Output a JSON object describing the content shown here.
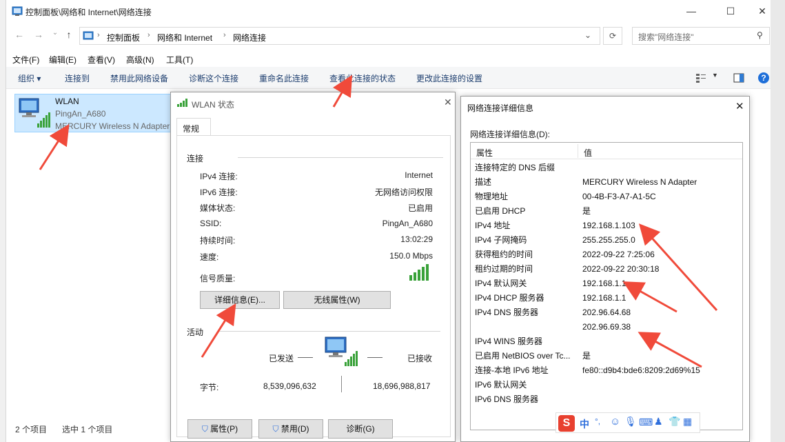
{
  "window": {
    "title": "控制面板\\网络和 Internet\\网络连接",
    "minimize": "—",
    "maximize": "☐",
    "close": "✕"
  },
  "address": {
    "crumbs": [
      "控制面板",
      "网络和 Internet",
      "网络连接"
    ],
    "search_placeholder": "搜索\"网络连接\""
  },
  "menu": [
    "文件(F)",
    "编辑(E)",
    "查看(V)",
    "高级(N)",
    "工具(T)"
  ],
  "commands": [
    "组织 ▾",
    "连接到",
    "禁用此网络设备",
    "诊断这个连接",
    "重命名此连接",
    "查看此连接的状态",
    "更改此连接的设置"
  ],
  "connection": {
    "name": "WLAN",
    "ssid": "PingAn_A680",
    "adapter": "MERCURY Wireless N Adapter"
  },
  "status_bar": {
    "count": "2 个项目",
    "selected": "选中 1 个项目"
  },
  "status_dialog": {
    "title": "WLAN 状态",
    "tab": "常规",
    "section_connection": "连接",
    "rows": [
      {
        "label": "IPv4 连接:",
        "value": "Internet"
      },
      {
        "label": "IPv6 连接:",
        "value": "无网络访问权限"
      },
      {
        "label": "媒体状态:",
        "value": "已启用"
      },
      {
        "label": "SSID:",
        "value": "PingAn_A680"
      },
      {
        "label": "持续时间:",
        "value": "13:02:29"
      },
      {
        "label": "速度:",
        "value": "150.0 Mbps"
      }
    ],
    "signal_label": "信号质量:",
    "details_button": "详细信息(E)...",
    "wireless_button": "无线属性(W)",
    "section_activity": "活动",
    "sent_label": "已发送",
    "received_label": "已接收",
    "bytes_label": "字节:",
    "bytes_sent": "8,539,096,632",
    "bytes_received": "18,696,988,817",
    "properties_button": "属性(P)",
    "disable_button": "禁用(D)",
    "diagnose_button": "诊断(G)"
  },
  "details_dialog": {
    "title": "网络连接详细信息",
    "caption": "网络连接详细信息(D):",
    "col_property": "属性",
    "col_value": "值",
    "rows": [
      {
        "p": "连接特定的 DNS 后缀",
        "v": ""
      },
      {
        "p": "描述",
        "v": "MERCURY Wireless N Adapter"
      },
      {
        "p": "物理地址",
        "v": "00-4B-F3-A7-A1-5C"
      },
      {
        "p": "已启用 DHCP",
        "v": "是"
      },
      {
        "p": "IPv4 地址",
        "v": "192.168.1.103"
      },
      {
        "p": "IPv4 子网掩码",
        "v": "255.255.255.0"
      },
      {
        "p": "获得租约的时间",
        "v": "2022-09-22 7:25:06"
      },
      {
        "p": "租约过期的时间",
        "v": "2022-09-22 20:30:18"
      },
      {
        "p": "IPv4 默认网关",
        "v": "192.168.1.1"
      },
      {
        "p": "IPv4 DHCP 服务器",
        "v": "192.168.1.1"
      },
      {
        "p": "IPv4 DNS 服务器",
        "v": "202.96.64.68"
      },
      {
        "p": "",
        "v": "202.96.69.38"
      },
      {
        "p": "IPv4 WINS 服务器",
        "v": ""
      },
      {
        "p": "已启用 NetBIOS over Tc...",
        "v": "是"
      },
      {
        "p": "连接-本地 IPv6 地址",
        "v": "fe80::d9b4:bde6:8209:2d69%15"
      },
      {
        "p": "IPv6 默认网关",
        "v": ""
      },
      {
        "p": "IPv6 DNS 服务器",
        "v": ""
      }
    ]
  },
  "ime": {
    "logo": "S",
    "lang": "中",
    "punct": "°,"
  },
  "colors": {
    "accent_blue": "#1e6fd9",
    "selection": "#cce8ff",
    "arrow_red": "#f04a3a",
    "signal_green": "#3aa23a",
    "ime_red": "#e8402f",
    "ime_blue": "#2f6fdc"
  }
}
